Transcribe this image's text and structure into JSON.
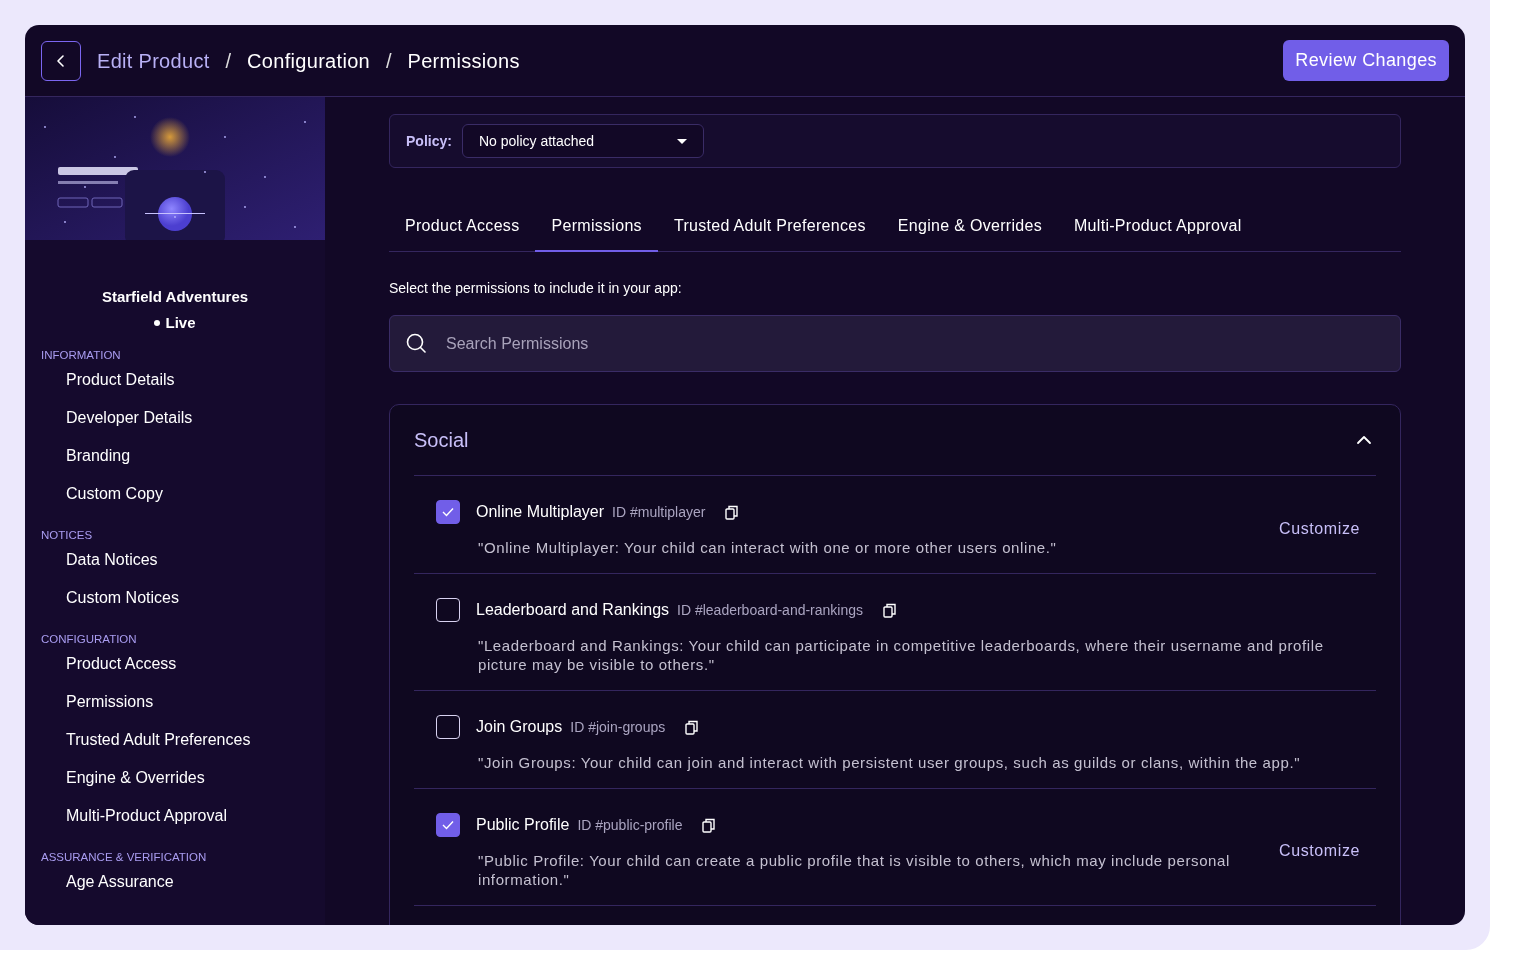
{
  "header": {
    "breadcrumbs": [
      {
        "label": "Edit Product",
        "current": false
      },
      {
        "label": "Configuration",
        "current": true
      },
      {
        "label": "Permissions",
        "current": true
      }
    ],
    "separator": "/",
    "action": "Review Changes"
  },
  "product": {
    "name": "Starfield Adventures",
    "status": "Live"
  },
  "sidebar": {
    "sections": [
      {
        "title": "INFORMATION",
        "items": [
          "Product Details",
          "Developer Details",
          "Branding",
          "Custom Copy"
        ]
      },
      {
        "title": "NOTICES",
        "items": [
          "Data Notices",
          "Custom Notices"
        ]
      },
      {
        "title": "CONFIGURATION",
        "items": [
          "Product Access",
          "Permissions",
          "Trusted Adult Preferences",
          "Engine & Overrides",
          "Multi-Product Approval"
        ]
      },
      {
        "title": "ASSURANCE & VERIFICATION",
        "items": [
          "Age Assurance"
        ]
      }
    ]
  },
  "policy": {
    "label": "Policy:",
    "value": "No policy attached"
  },
  "tabs": [
    {
      "label": "Product Access",
      "selected": false
    },
    {
      "label": "Permissions",
      "selected": true
    },
    {
      "label": "Trusted Adult Preferences",
      "selected": false
    },
    {
      "label": "Engine & Overrides",
      "selected": false
    },
    {
      "label": "Multi-Product Approval",
      "selected": false
    }
  ],
  "prompt": "Select the permissions to include it in your app:",
  "search": {
    "placeholder": "Search Permissions"
  },
  "group": {
    "title": "Social",
    "expanded": true,
    "permissions": [
      {
        "name": "Online Multiplayer",
        "id": "ID #multiplayer",
        "checked": true,
        "description": "\"Online Multiplayer: Your child can interact with one or more other users online.\"",
        "action": "Customize"
      },
      {
        "name": "Leaderboard and Rankings",
        "id": "ID #leaderboard-and-rankings",
        "checked": false,
        "description": "\"Leaderboard and Rankings: Your child can participate in competitive leaderboards, where their username and profile picture may be visible to others.\""
      },
      {
        "name": "Join Groups",
        "id": "ID #join-groups",
        "checked": false,
        "description": "\"Join Groups: Your child can join and interact with persistent user groups, such as guilds or clans, within the app.\""
      },
      {
        "name": "Public Profile",
        "id": "ID #public-profile",
        "checked": true,
        "description": "\"Public Profile: Your child can create a public profile that is visible to others, which may include personal information.\"",
        "action": "Customize"
      }
    ]
  }
}
